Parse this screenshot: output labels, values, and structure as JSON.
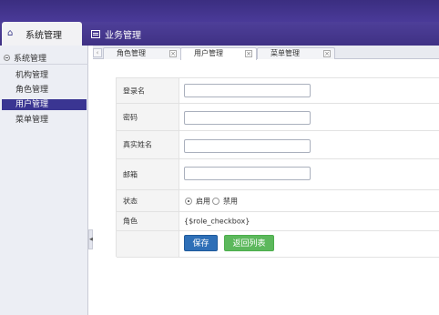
{
  "top_tabs": {
    "system": "系统管理",
    "business": "业务管理"
  },
  "sidebar": {
    "group_label": "系统管理",
    "items": [
      {
        "label": "机构管理"
      },
      {
        "label": "角色管理"
      },
      {
        "label": "用户管理",
        "active": true
      },
      {
        "label": "菜单管理"
      }
    ]
  },
  "content_tabs": [
    {
      "label": "角色管理",
      "active": false
    },
    {
      "label": "用户管理",
      "active": true
    },
    {
      "label": "菜单管理",
      "active": false
    }
  ],
  "form": {
    "login_label": "登录名",
    "login_value": "",
    "password_label": "密码",
    "password_value": "",
    "realname_label": "真实姓名",
    "realname_value": "",
    "email_label": "邮箱",
    "email_value": "",
    "status_label": "状态",
    "status_options": {
      "enabled": "启用",
      "disabled": "禁用"
    },
    "status_selected": "启用",
    "role_label": "角色",
    "role_value": "{$role_checkbox}",
    "save_button": "保存",
    "back_button": "返回列表"
  },
  "colors": {
    "header": "#3b2e80",
    "sidebar_active": "#3a3592",
    "save_button": "#2e6fb7",
    "back_button": "#5cb85c"
  }
}
